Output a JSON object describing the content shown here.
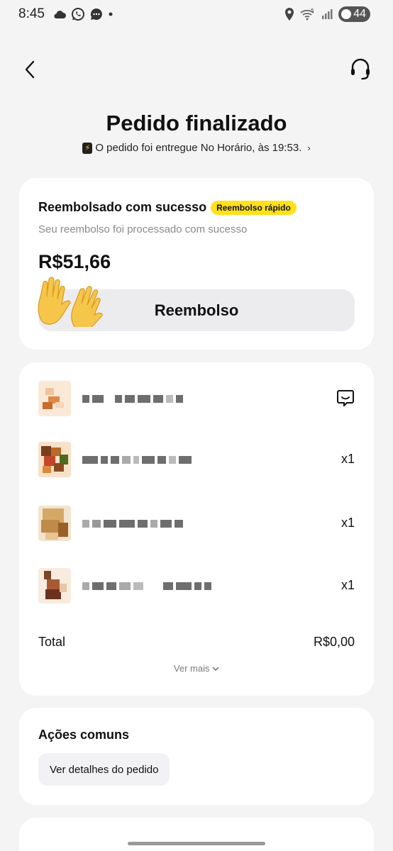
{
  "status_bar": {
    "time": "8:45",
    "battery": "44",
    "icons_left": [
      "cloud-icon",
      "whatsapp-icon",
      "messages-icon",
      "dot-icon"
    ],
    "icons_right": [
      "location-icon",
      "wifi-5-icon",
      "signal-icon",
      "battery-icon"
    ]
  },
  "header": {
    "title": "Pedido finalizado",
    "delivery_text": "O pedido foi entregue No Horário, às 19:53."
  },
  "refund": {
    "title": "Reembolsado com sucesso",
    "badge": "Reembolso rápido",
    "subtitle": "Seu reembolso foi processado com sucesso",
    "amount": "R$51,66",
    "button_label": "Reembolso"
  },
  "order": {
    "items": [
      {
        "quantity": ""
      },
      {
        "quantity": "x1"
      },
      {
        "quantity": "x1"
      },
      {
        "quantity": "x1"
      }
    ],
    "total_label": "Total",
    "total_value": "R$0,00",
    "see_more": "Ver mais"
  },
  "actions": {
    "title": "Ações comuns",
    "details_button": "Ver detalhes do pedido"
  },
  "colors": {
    "accent_yellow": "#ffe11a",
    "background": "#f4f4f5",
    "card": "#ffffff"
  }
}
